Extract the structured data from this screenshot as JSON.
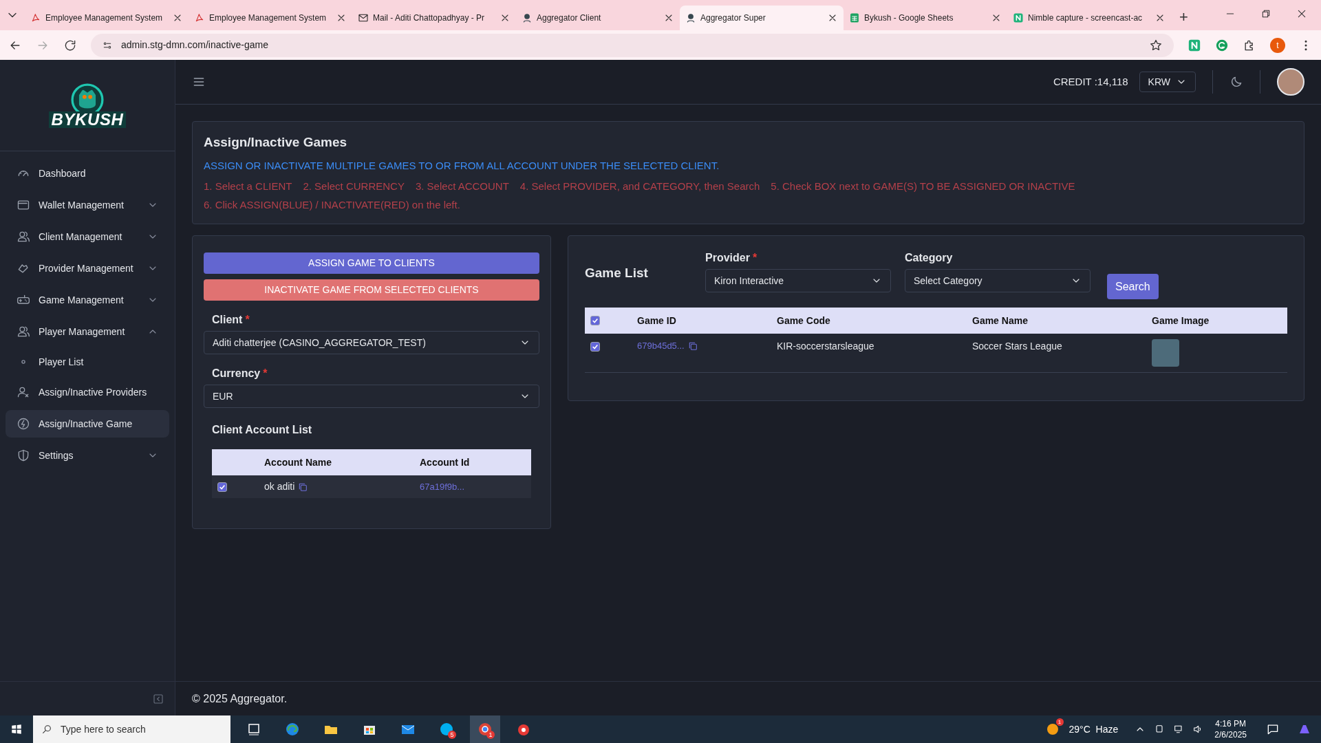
{
  "browser": {
    "tabs": [
      {
        "title": "Employee Management System",
        "selected": false
      },
      {
        "title": "Employee Management System",
        "selected": false
      },
      {
        "title": "Mail - Aditi Chattopadhyay - Pr",
        "selected": false
      },
      {
        "title": "Aggregator Client",
        "selected": false
      },
      {
        "title": "Aggregator Super",
        "selected": true
      },
      {
        "title": "Bykush - Google Sheets",
        "selected": false
      },
      {
        "title": "Nimble capture - screencast-ac",
        "selected": false
      }
    ],
    "new_tab": "+",
    "address": "admin.stg-dmn.com/inactive-game",
    "profile": "t"
  },
  "sidebar": {
    "logo": "BYKUSH",
    "items": [
      {
        "label": "Dashboard",
        "selected": false
      },
      {
        "label": "Wallet Management",
        "selected": false,
        "expanded": false
      },
      {
        "label": "Client Management",
        "selected": false,
        "expanded": false
      },
      {
        "label": "Provider Management",
        "selected": false,
        "expanded": false
      },
      {
        "label": "Game Management",
        "selected": false,
        "expanded": false
      },
      {
        "label": "Player Management",
        "selected": false,
        "expanded": true,
        "children": [
          {
            "label": "Player List",
            "selected": false
          }
        ]
      },
      {
        "label": "Assign/Inactive Providers",
        "selected": false
      },
      {
        "label": "Assign/Inactive Game",
        "selected": true
      },
      {
        "label": "Settings",
        "selected": false,
        "expanded": false
      }
    ]
  },
  "header": {
    "credit": "CREDIT :14,118",
    "currency": "KRW"
  },
  "info": {
    "title": "Assign/Inactive Games",
    "subtitle": "ASSIGN OR INACTIVATE MULTIPLE GAMES TO OR FROM ALL ACCOUNT UNDER THE SELECTED CLIENT.",
    "steps": [
      "1. Select a CLIENT",
      "2. Select CURRENCY",
      "3. Select ACCOUNT",
      "4. Select PROVIDER, and CATEGORY, then Search",
      "5. Check BOX next to GAME(S) TO BE ASSIGNED OR INACTIVE",
      "6. Click ASSIGN(BLUE) / INACTIVATE(RED) on the left."
    ]
  },
  "assign_panel": {
    "buttons": [
      {
        "label": "ASSIGN GAME TO CLIENTS",
        "kind": "assign"
      },
      {
        "label": "INACTIVATE GAME FROM SELECTED CLIENTS",
        "kind": "inactivate"
      }
    ],
    "fields": [
      {
        "label": "Client",
        "required_mark": "*",
        "value": "Aditi chatterjee (CASINO_AGGREGATOR_TEST)"
      },
      {
        "label": "Currency",
        "required_mark": "*",
        "value": "EUR"
      }
    ],
    "account_list": {
      "title": "Client Account List",
      "columns": [
        "Account Name",
        "Account Id"
      ],
      "rows": [
        {
          "checked": true,
          "name": "ok aditi",
          "id": "67a19f9b..."
        }
      ]
    }
  },
  "game_list": {
    "title": "Game List",
    "filters": [
      {
        "label": "Provider",
        "required_mark": "*",
        "value": "Kiron Interactive"
      },
      {
        "label": "Category",
        "placeholder": "Select Category"
      }
    ],
    "search": "Search",
    "all_checked": true,
    "columns": [
      "Game ID",
      "Game Code",
      "Game Name",
      "Game Image"
    ],
    "rows": [
      {
        "checked": true,
        "id": "679b45d5...",
        "code": "KIR-soccerstarsleague",
        "name": "Soccer Stars League"
      }
    ]
  },
  "footer": "© 2025 Aggregator.",
  "taskbar": {
    "search_placeholder": "Type here to search",
    "skype_badge": "5",
    "chrome_badge": "1",
    "weather_badge": "1",
    "weather": "29°C  Haze",
    "time": "4:16 PM",
    "date": "2/6/2025"
  }
}
